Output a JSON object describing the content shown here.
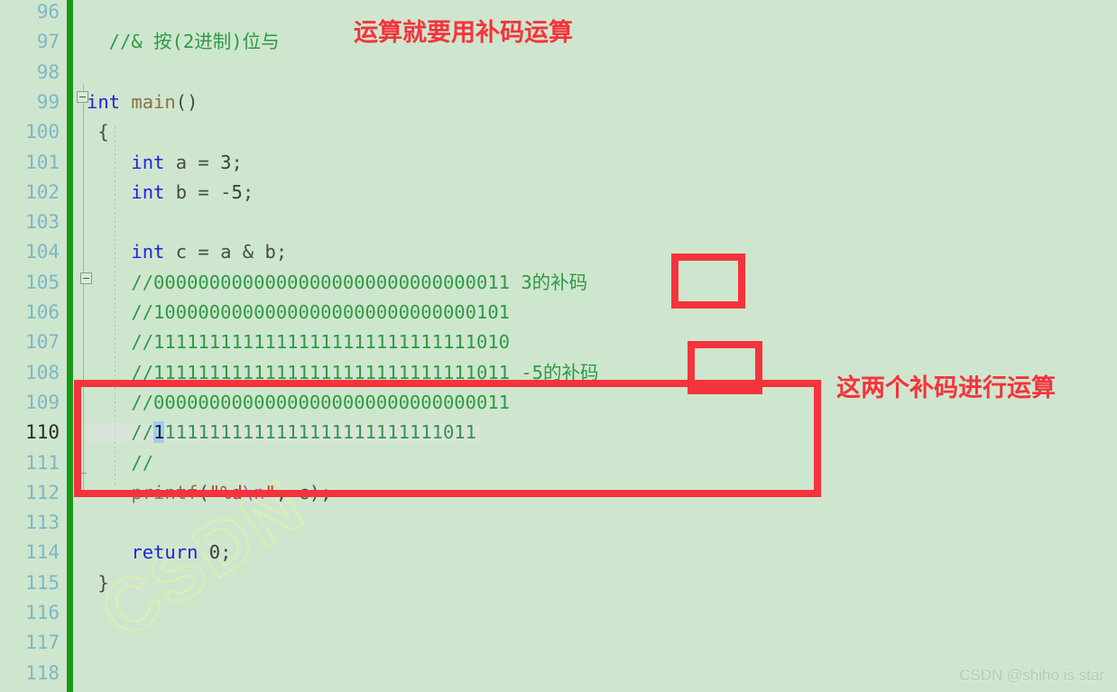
{
  "editor": {
    "background_color": "#cee6ce",
    "gutter_number_color": "#7fb6c6",
    "current_line_number_color": "#2b2b2b",
    "comment_color": "#2e9a44",
    "keyword_color": "#2222dd",
    "string_color": "#c0392b",
    "escape_color": "#b44ad6",
    "function_color": "#8a7246",
    "change_bar_color": "#1a9a1a",
    "annotation_color": "#f5333c",
    "selection_color": "#9fcdee",
    "first_line_number": 96,
    "last_line_number": 118,
    "current_line": 110,
    "line_numbers": [
      96,
      97,
      98,
      99,
      100,
      101,
      102,
      103,
      104,
      105,
      106,
      107,
      108,
      109,
      110,
      111,
      112,
      113,
      114,
      115,
      116,
      117,
      118
    ],
    "lines": [
      {
        "n": 96,
        "segments": []
      },
      {
        "n": 97,
        "segments": [
          {
            "t": "  //& 按(2进制)位与",
            "c": "cmt"
          }
        ]
      },
      {
        "n": 98,
        "segments": []
      },
      {
        "n": 99,
        "segments": [
          {
            "t": "int ",
            "c": "kw"
          },
          {
            "t": "main",
            "c": "fn"
          },
          {
            "t": "()",
            "c": "punct"
          }
        ]
      },
      {
        "n": 100,
        "segments": [
          {
            "t": " {",
            "c": "punct"
          }
        ]
      },
      {
        "n": 101,
        "segments": [
          {
            "t": "    ",
            "c": "plain"
          },
          {
            "t": "int",
            "c": "kw"
          },
          {
            "t": " a = ",
            "c": "plain"
          },
          {
            "t": "3",
            "c": "num"
          },
          {
            "t": ";",
            "c": "punct"
          }
        ]
      },
      {
        "n": 102,
        "segments": [
          {
            "t": "    ",
            "c": "plain"
          },
          {
            "t": "int",
            "c": "kw"
          },
          {
            "t": " b = -",
            "c": "plain"
          },
          {
            "t": "5",
            "c": "num"
          },
          {
            "t": ";",
            "c": "punct"
          }
        ]
      },
      {
        "n": 103,
        "segments": []
      },
      {
        "n": 104,
        "segments": [
          {
            "t": "    ",
            "c": "plain"
          },
          {
            "t": "int",
            "c": "kw"
          },
          {
            "t": " c = a & b;",
            "c": "plain"
          }
        ]
      },
      {
        "n": 105,
        "segments": [
          {
            "t": "    //00000000000000000000000000000011 3的补码",
            "c": "cmt"
          }
        ]
      },
      {
        "n": 106,
        "segments": [
          {
            "t": "    //10000000000000000000000000000101",
            "c": "cmt"
          }
        ]
      },
      {
        "n": 107,
        "segments": [
          {
            "t": "    //11111111111111111111111111111010",
            "c": "cmt"
          }
        ]
      },
      {
        "n": 108,
        "segments": [
          {
            "t": "    //11111111111111111111111111111011 -5的补码",
            "c": "cmt"
          }
        ]
      },
      {
        "n": 109,
        "segments": [
          {
            "t": "    //00000000000000000000000000000011",
            "c": "cmt"
          }
        ]
      },
      {
        "n": 110,
        "segments": [
          {
            "t": "    //",
            "c": "cmt"
          },
          {
            "t": "1",
            "c": "sel"
          },
          {
            "t": "1111111111111111111111111011",
            "c": "cmt"
          }
        ]
      },
      {
        "n": 111,
        "segments": [
          {
            "t": "    //",
            "c": "cmt"
          }
        ]
      },
      {
        "n": 112,
        "segments": [
          {
            "t": "    ",
            "c": "plain"
          },
          {
            "t": "printf",
            "c": "fn"
          },
          {
            "t": "(",
            "c": "punct"
          },
          {
            "t": "\"%d",
            "c": "str"
          },
          {
            "t": "\\n",
            "c": "esc"
          },
          {
            "t": "\"",
            "c": "str"
          },
          {
            "t": ", c);",
            "c": "plain"
          }
        ]
      },
      {
        "n": 113,
        "segments": []
      },
      {
        "n": 114,
        "segments": [
          {
            "t": "    ",
            "c": "plain"
          },
          {
            "t": "return",
            "c": "kw"
          },
          {
            "t": " ",
            "c": "plain"
          },
          {
            "t": "0",
            "c": "num"
          },
          {
            "t": ";",
            "c": "punct"
          }
        ]
      },
      {
        "n": 115,
        "segments": [
          {
            "t": " }",
            "c": "punct"
          }
        ]
      },
      {
        "n": 116,
        "segments": []
      },
      {
        "n": 117,
        "segments": []
      },
      {
        "n": 118,
        "segments": []
      }
    ]
  },
  "annotations": {
    "title_note": "运算就要用补码运算",
    "side_note": "这两个补码进行运算",
    "box_label_3": "3的补码",
    "box_label_neg5": "-5的补码"
  },
  "watermarks": {
    "diagonal": "CSDN",
    "credit": "CSDN @shiho is star"
  }
}
